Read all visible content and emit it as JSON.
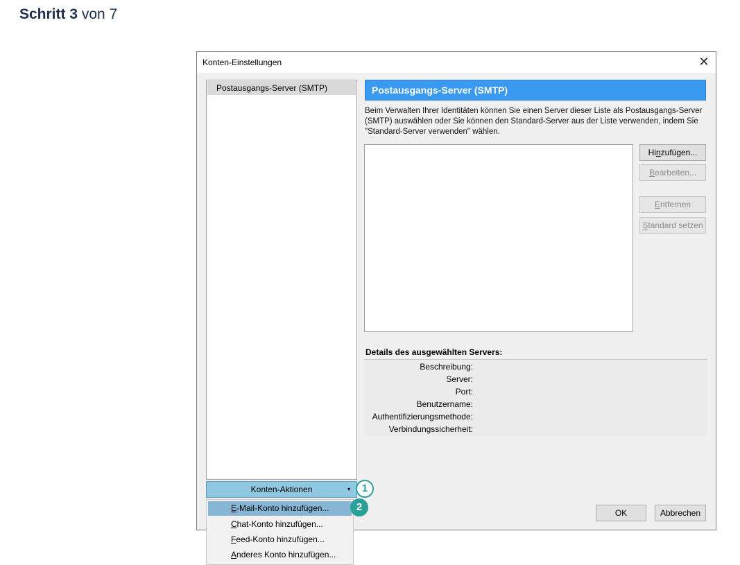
{
  "step": {
    "prefix": "Schritt 3",
    "suffix": "von 7"
  },
  "dialog": {
    "title": "Konten-Einstellungen",
    "close_glyph": "✕",
    "tree_item": "Postausgangs-Server (SMTP)",
    "header": "Postausgangs-Server (SMTP)",
    "description": "Beim Verwalten Ihrer Identitäten können Sie einen Server dieser Liste als Postausgangs-Server (SMTP) auswählen oder Sie können den Standard-Server aus der Liste verwenden, indem Sie \"Standard-Server verwenden\" wählen.",
    "buttons": {
      "add": {
        "pre": "Hi",
        "ul": "n",
        "post": "zufügen..."
      },
      "edit": {
        "pre": "",
        "ul": "B",
        "post": "earbeiten..."
      },
      "remove": {
        "pre": "",
        "ul": "E",
        "post": "ntfernen"
      },
      "default": {
        "pre": "",
        "ul": "S",
        "post": "tandard setzen"
      },
      "ok": "OK",
      "cancel": "Abbrechen"
    },
    "details_title": "Details des ausgewählten Servers:",
    "details": {
      "description": "Beschreibung:",
      "server": "Server:",
      "port": "Port:",
      "username": "Benutzername:",
      "auth": "Authentifizierungsmethode:",
      "security": "Verbindungssicherheit:"
    },
    "account_actions": {
      "ul": "K",
      "post": "onten-Aktionen",
      "arrow": "▾"
    }
  },
  "menu": {
    "email": {
      "ul": "E",
      "post": "-Mail-Konto hinzufügen..."
    },
    "chat": {
      "ul": "C",
      "post": "hat-Konto hinzufügen..."
    },
    "feed": {
      "ul": "F",
      "post": "eed-Konto hinzufügen..."
    },
    "other": {
      "ul": "A",
      "post": "nderes Konto hinzufügen..."
    }
  },
  "badges": {
    "one": "1",
    "two": "2"
  },
  "colors": {
    "header_blue": "#3a99f0",
    "badge_teal": "#2aa198",
    "highlight": "#86b6d3"
  }
}
